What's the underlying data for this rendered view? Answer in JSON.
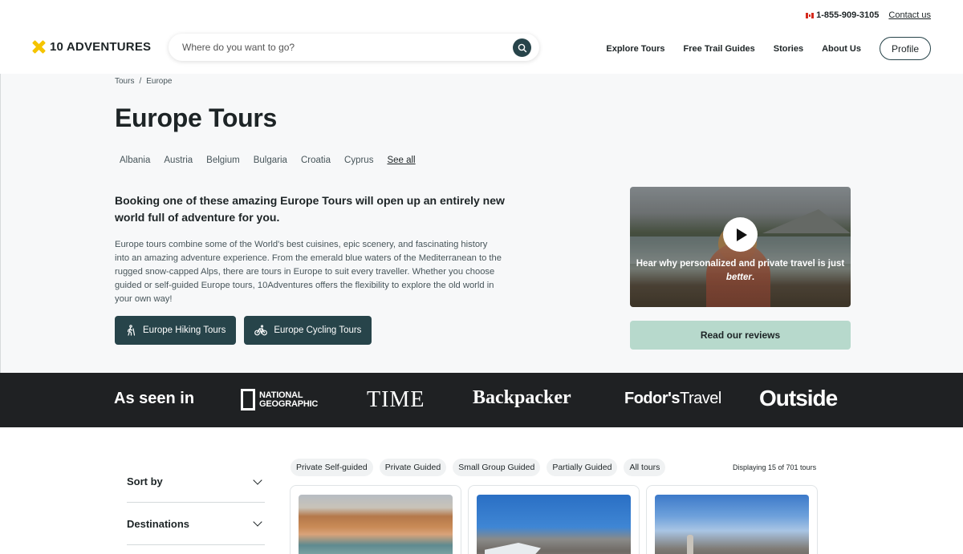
{
  "header": {
    "phone": "1-855-909-3105",
    "contact_label": "Contact us",
    "logo_text": "10 ADVENTURES",
    "search_placeholder": "Where do you want to go?",
    "nav": {
      "explore": "Explore Tours",
      "trail_guides": "Free Trail Guides",
      "stories": "Stories",
      "about": "About Us",
      "profile": "Profile"
    }
  },
  "breadcrumb": {
    "root": "Tours",
    "separator": "/",
    "current": "Europe"
  },
  "page_title": "Europe Tours",
  "countries": [
    "Albania",
    "Austria",
    "Belgium",
    "Bulgaria",
    "Croatia",
    "Cyprus"
  ],
  "see_all_label": "See all",
  "intro": {
    "lead": "Booking one of these amazing Europe Tours will open up an entirely new world full of adventure for you.",
    "body": "Europe tours combine some of the World's best cuisines, epic scenery, and fascinating history into an amazing adventure experience. From the emerald blue waters of the Mediterranean to the rugged snow-capped Alps, there are tours in Europe to suit every traveller. Whether you choose guided or self-guided Europe tours, 10Adventures offers the flexibility to explore the old world in your own way!"
  },
  "cta": {
    "hiking": "Europe Hiking Tours",
    "cycling": "Europe Cycling Tours"
  },
  "video": {
    "caption_main": "Hear why personalized and private travel is just",
    "caption_emph": "better",
    "caption_end": "."
  },
  "reviews_label": "Read our reviews",
  "press": {
    "label": "As seen in",
    "natgeo_line1": "NATIONAL",
    "natgeo_line2": "GEOGRAPHIC",
    "time": "TIME",
    "backpacker": "Backpacker",
    "fodors_bold": "Fodor's",
    "fodors_rest": "Travel",
    "outside": "Outside"
  },
  "filters": {
    "sort": "Sort by",
    "destinations": "Destinations"
  },
  "tabs": [
    "Private Self-guided",
    "Private Guided",
    "Small Group Guided",
    "Partially Guided",
    "All tours"
  ],
  "result_count": "Displaying 15 of 701 tours",
  "colors": {
    "accent": "#27444a",
    "reviews_bg": "#b7d9cc",
    "press_bg": "#1f2123",
    "logo_yellow": "#f5c400"
  }
}
